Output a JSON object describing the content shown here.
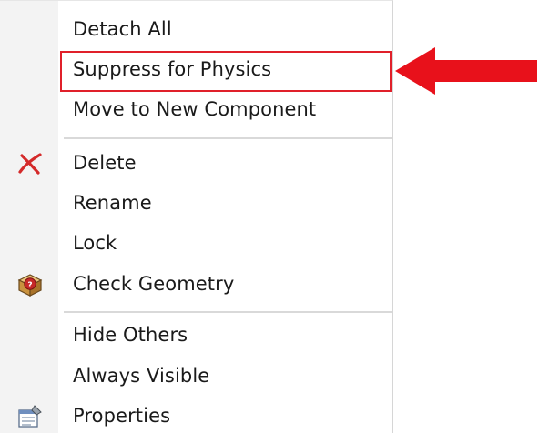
{
  "context_menu": {
    "items": [
      {
        "label": "Detach All",
        "icon": ""
      },
      {
        "label": "Suppress for Physics",
        "icon": "",
        "highlighted": true
      },
      {
        "label": "Move to New Component",
        "icon": ""
      },
      {
        "label": "Delete",
        "icon": "delete-x-icon"
      },
      {
        "label": "Rename",
        "icon": ""
      },
      {
        "label": "Lock",
        "icon": ""
      },
      {
        "label": "Check Geometry",
        "icon": "check-geometry-icon"
      },
      {
        "label": "Hide Others",
        "icon": ""
      },
      {
        "label": "Always Visible",
        "icon": ""
      },
      {
        "label": "Properties",
        "icon": "properties-icon"
      }
    ]
  },
  "annotation": {
    "highlight_color": "#e0202a",
    "arrow_color": "#e8111b",
    "arrow_icon": "red-arrow-pointing-left"
  },
  "colors": {
    "menu_bg": "#ffffff",
    "gutter_bg": "#f3f3f3",
    "separator": "#d9d9d9",
    "text": "#1a1a1a"
  }
}
